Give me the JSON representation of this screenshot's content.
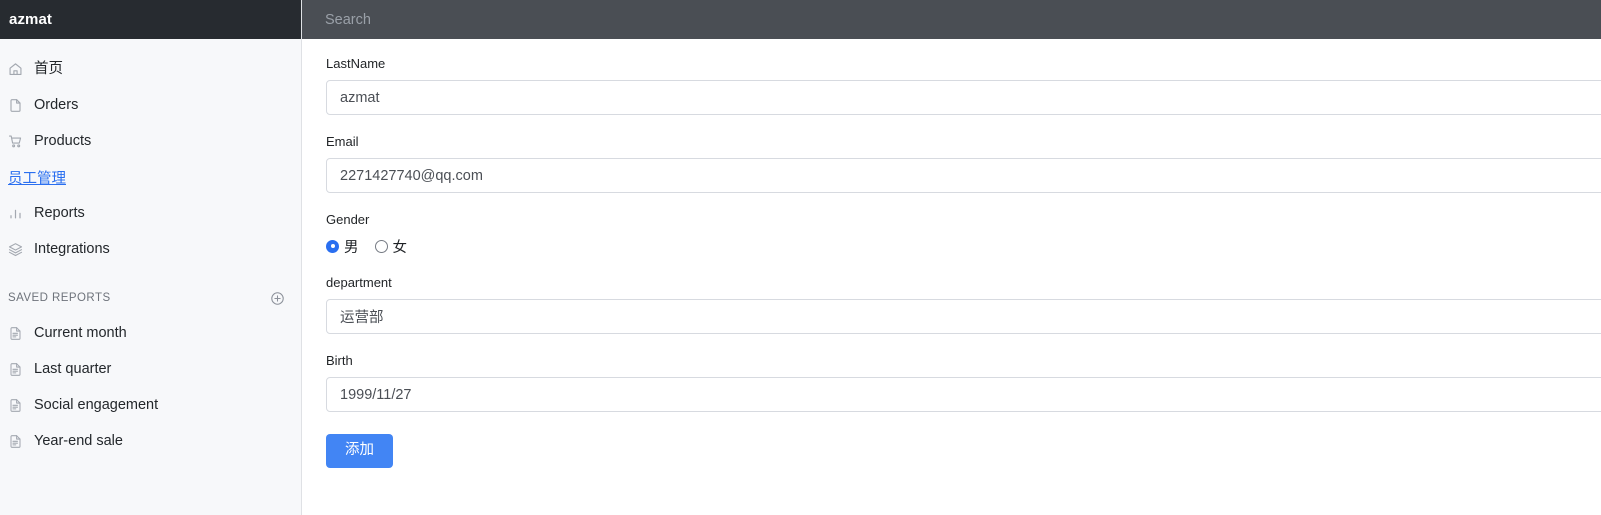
{
  "sidebar": {
    "brand": "azmat",
    "nav_items": [
      {
        "label": "首页",
        "icon": "home-icon"
      },
      {
        "label": "Orders",
        "icon": "file-icon"
      },
      {
        "label": "Products",
        "icon": "shopping-cart-icon"
      }
    ],
    "nav_link": {
      "label": "员工管理",
      "color": "#2a6ff0"
    },
    "nav_items_after": [
      {
        "label": "Reports",
        "icon": "bar-chart-icon"
      },
      {
        "label": "Integrations",
        "icon": "layers-icon"
      }
    ],
    "section": {
      "title": "SAVED REPORTS",
      "add_icon": "plus-circle-icon"
    },
    "reports": [
      {
        "label": "Current month",
        "icon": "document-icon"
      },
      {
        "label": "Last quarter",
        "icon": "document-icon"
      },
      {
        "label": "Social engagement",
        "icon": "document-icon"
      },
      {
        "label": "Year-end sale",
        "icon": "document-icon"
      }
    ]
  },
  "topbar": {
    "search_placeholder": "Search",
    "search_value": ""
  },
  "form": {
    "lastname": {
      "label": "LastName",
      "value": "azmat",
      "placeholder": ""
    },
    "email": {
      "label": "Email",
      "value": "2271427740@qq.com",
      "placeholder": ""
    },
    "gender": {
      "label": "Gender",
      "options": [
        {
          "label": "男",
          "checked": true
        },
        {
          "label": "女",
          "checked": false
        }
      ]
    },
    "department": {
      "label": "department",
      "value": "运营部",
      "placeholder": ""
    },
    "birth": {
      "label": "Birth",
      "value": "1999/11/27",
      "placeholder": ""
    },
    "submit_label": "添加"
  },
  "colors": {
    "brand_bg": "#272b30",
    "topbar_bg": "#4a4e54",
    "sidebar_bg": "#f7f8fa",
    "accent": "#4285f4",
    "link": "#2a6ff0"
  }
}
